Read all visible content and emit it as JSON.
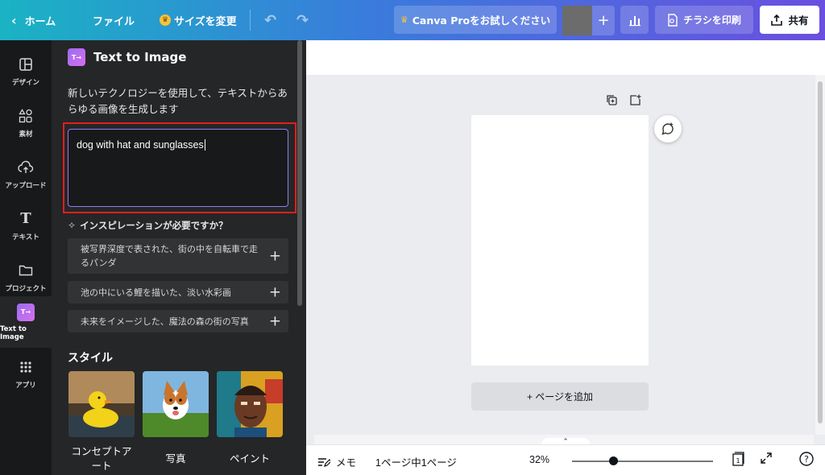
{
  "topbar": {
    "home": "ホーム",
    "file": "ファイル",
    "resize": "サイズを変更",
    "pro_trial": "Canva Proをお試しください",
    "print": "チラシを印刷",
    "share": "共有"
  },
  "rail": {
    "items": [
      {
        "label": "デザイン",
        "icon": "layout-icon"
      },
      {
        "label": "素材",
        "icon": "elements-icon"
      },
      {
        "label": "アップロード",
        "icon": "upload-cloud-icon"
      },
      {
        "label": "テキスト",
        "icon": "text-icon"
      },
      {
        "label": "プロジェクト",
        "icon": "folder-icon"
      },
      {
        "label": "Text to Image",
        "icon": "text-to-image-icon"
      },
      {
        "label": "アプリ",
        "icon": "apps-grid-icon"
      }
    ]
  },
  "panel": {
    "title": "Text to Image",
    "description": "新しいテクノロジーを使用して、テキストからあらゆる画像を生成します",
    "prompt_value": "dog with hat and sunglasses",
    "inspiration_heading": "インスピレーションが必要ですか？",
    "suggestions": [
      "被写界深度で表された、街の中を自転車で走るパンダ",
      "池の中にいる鯉を描いた、淡い水彩画",
      "未来をイメージした、魔法の森の街の写真"
    ],
    "style_heading": "スタイル",
    "styles": [
      {
        "label": "コンセプトアート"
      },
      {
        "label": "写真"
      },
      {
        "label": "ペイント"
      }
    ]
  },
  "canvas": {
    "add_page": "+ ページを追加"
  },
  "bottombar": {
    "memo": "メモ",
    "pages": "1ページ中1ページ",
    "zoom": "32%",
    "page_count": "1"
  },
  "colors": {
    "accent": "#8b7ff0",
    "highlight_border": "#e01f1f",
    "panel_bg": "#252627",
    "rail_bg": "#18191b"
  }
}
